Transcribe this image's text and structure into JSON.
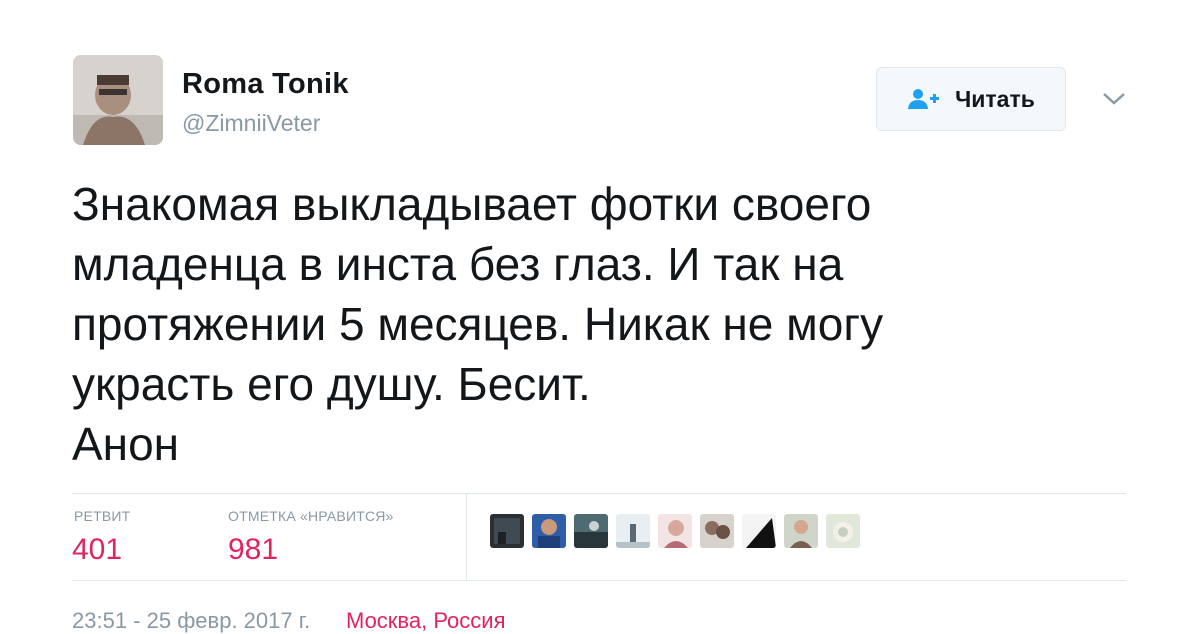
{
  "author": {
    "name": "Roma Tonik",
    "handle": "@ZimniiVeter"
  },
  "follow_button": {
    "label": "Читать",
    "icon": "add-user-icon"
  },
  "menu_icon": "chevron-down-icon",
  "tweet": {
    "text": "Знакомая выкладывает фотки своего\nмладенца в инста без глаз. И так на\nпротяжении 5 месяцев. Никак не могу\nукрасть его душу. Бесит.\nАнон"
  },
  "stats": {
    "retweets_label": "РЕТВИТ",
    "retweets_value": "401",
    "likes_label": "ОТМЕТКА «НРАВИТСЯ»",
    "likes_value": "981"
  },
  "likers_count": 9,
  "footer": {
    "timestamp": "23:51 - 25 февр. 2017 г.",
    "location": "Москва, Россия"
  },
  "colors": {
    "text": "#14171a",
    "muted": "#8899a6",
    "accent_like": "#e0245e",
    "follow_icon": "#1da1f2",
    "border": "#e1e8ed"
  }
}
